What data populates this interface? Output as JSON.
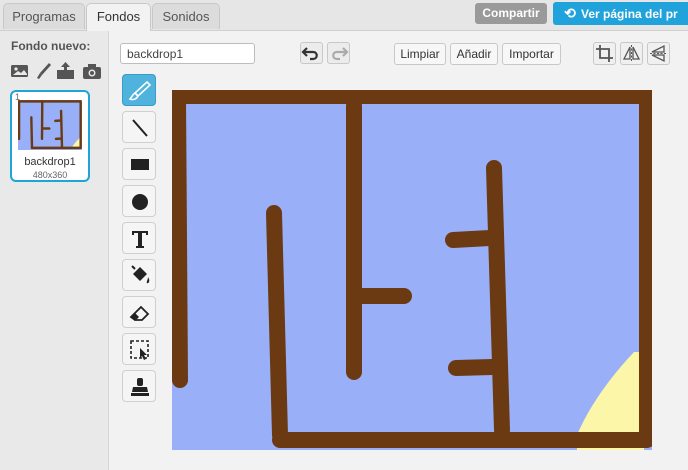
{
  "tabs": [
    {
      "label": "Programas"
    },
    {
      "label": "Fondos"
    },
    {
      "label": "Sonidos"
    }
  ],
  "header": {
    "share_label": "Compartir",
    "project_page_label": "Ver página del pr"
  },
  "new_backdrop": {
    "label": "Fondo nuevo:",
    "tools": [
      "image-library-icon",
      "paint-brush-icon",
      "upload-icon",
      "camera-icon"
    ]
  },
  "backdrops": [
    {
      "number": "1",
      "name": "backdrop1",
      "size": "480x360"
    }
  ],
  "editor": {
    "name_value": "backdrop1",
    "clear_label": "Limpiar",
    "add_label": "Añadir",
    "import_label": "Importar"
  },
  "tools": [
    "brush-icon",
    "line-icon",
    "rectangle-icon",
    "ellipse-icon",
    "text-icon",
    "fill-icon",
    "eraser-icon",
    "select-icon",
    "stamp-icon"
  ],
  "colors": {
    "maze_wall": "#6b3a12",
    "maze_floor": "#99b0f8",
    "yellow": "#fcf6a8",
    "accent": "#20a2da"
  }
}
